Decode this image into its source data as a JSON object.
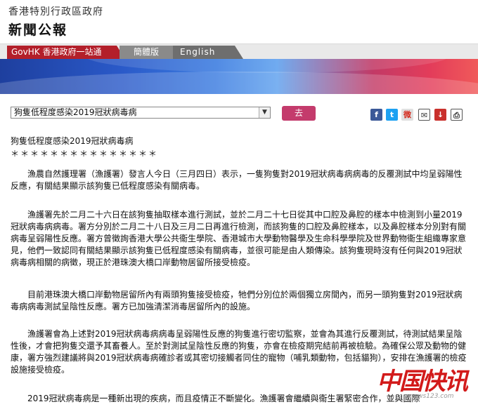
{
  "header": {
    "gov_name": "香港特別行政區政府",
    "press_title": "新聞公報"
  },
  "nav": {
    "govhk": "GovHK 香港政府一站通",
    "simplified": "簡體版",
    "english": "English"
  },
  "toolbar": {
    "select_value": "狗隻低程度感染2019冠狀病毒病",
    "go_label": "去",
    "share_icons": [
      "facebook-icon",
      "twitter-icon",
      "weibo-icon",
      "email-icon",
      "download-icon",
      "print-icon"
    ]
  },
  "article": {
    "title": "狗隻低程度感染2019冠狀病毒病",
    "stars": "＊＊＊＊＊＊＊＊＊＊＊＊＊＊＊",
    "paragraphs": [
      "漁農自然護理署（漁護署）發言人今日（三月四日）表示，一隻狗隻對2019冠狀病毒病病毒的反覆測試中均呈弱陽性反應，有關結果顯示該狗隻已低程度感染有關病毒。",
      "漁護署先於二月二十六日在該狗隻抽取樣本進行測試，並於二月二十七日從其中口腔及鼻腔的樣本中檢測到小量2019冠狀病毒病病毒。署方分別於二月二十八日及三月二日再進行檢測，而該狗隻的口腔及鼻腔樣本，以及鼻腔樣本分別對有關病毒呈弱陽性反應。署方曾徵詢香港大學公共衞生學院、香港城市大學動物醫學及生命科學學院及世界動物衞生組織專家意見，他們一致認同有關結果顯示該狗隻已低程度感染有關病毒，並很可能是由人類傳染。該狗隻現時沒有任何與2019冠狀病毒病相關的病徵，現正於港珠澳大橋口岸動物居留所接受檢疫。",
      "目前港珠澳大橋口岸動物居留所內有兩頭狗隻接受檢疫，牠們分別位於兩個獨立房間內，而另一頭狗隻對2019冠狀病毒病病毒測試呈陰性反應。署方已加強清潔消毒居留所內的設施。",
      "漁護署會為上述對2019冠狀病毒病病毒呈弱陽性反應的狗隻進行密切監察，並會為其進行反覆測試，待測試結果呈陰性後，才會把狗隻交還予其畜養人。至於對測試呈陰性反應的狗隻，亦會在檢疫期完結前再被檢驗。為確保公眾及動物的健康，署方強烈建議將與2019冠狀病毒病確診者或其密切接觸者同住的寵物（哺乳類動物，包括貓狗），安排在漁護署的檢疫設施接受檢疫。",
      "2019冠狀病毒病是一種新出現的疾病，而且疫情正不斷變化。漁護署會繼續與衞生署緊密合作，並與國際"
    ]
  },
  "watermark": {
    "text": "中国快讯",
    "url": "cnews123.com"
  },
  "colors": {
    "gov_red": "#b31f2a",
    "go_button": "#c43b6c"
  }
}
